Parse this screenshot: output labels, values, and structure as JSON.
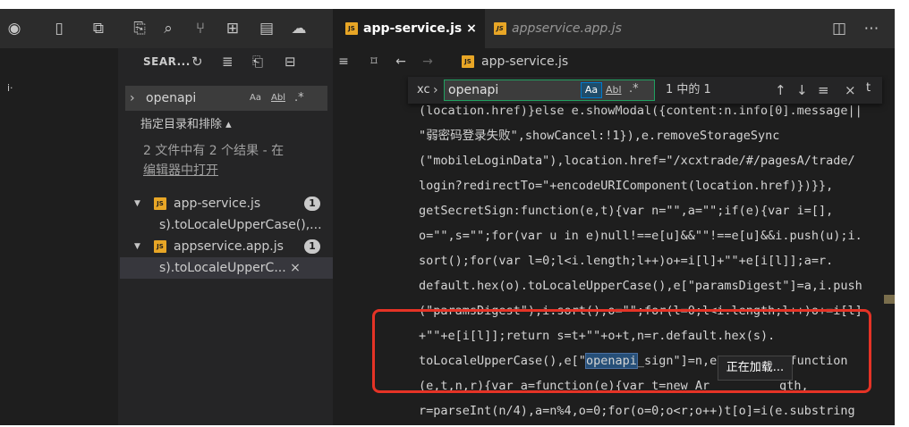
{
  "sidebar": {
    "title": "SEAR...",
    "search_value": "openapi",
    "opt_case": "Aa",
    "opt_word": "Abl",
    "opt_regex": ".*",
    "include_toggle": "指定目录和排除 ▴",
    "summary": "2 文件中有 2 个结果 - 在",
    "summary_link": "编辑器中打开",
    "results": [
      {
        "file": "app-service.js",
        "count": "1",
        "match": "s).toLocaleUpperCase(),..."
      },
      {
        "file": "appservice.app.js",
        "count": "1",
        "match": "s).toLocaleUpperC... ×"
      }
    ]
  },
  "tabs": [
    {
      "label": "app-service.js ×"
    },
    {
      "label": "appservice.app.js"
    }
  ],
  "breadcrumb": {
    "file": "app-service.js"
  },
  "find": {
    "prefix": "xc",
    "value": "openapi",
    "case_label": "Aa",
    "word_label": "Abl",
    "regex_label": ".*",
    "count": "1 中的 1",
    "suffix": "t"
  },
  "code_lines": [
    "(location.href)}else e.showModal({content:n.info[0].message||",
    "\"弱密码登录失败\",showCancel:!1}),e.removeStorageSync",
    "(\"mobileLoginData\"),location.href=\"/xcxtrade/#/pagesA/trade/",
    "login?redirectTo=\"+encodeURIComponent(location.href)})}},",
    "getSecretSign:function(e,t){var n=\"\",a=\"\";if(e){var i=[],",
    "o=\"\",s=\"\";for(var u in e)null!==e[u]&&\"\"!==e[u]&&i.push(u);i.",
    "sort();for(var l=0;l<i.length;l++)o+=i[l]+\"\"+e[i[l]];a=r.",
    "default.hex(o).toLocaleUpperCase(),e[\"paramsDigest\"]=a,i.push",
    "(\"paramsDigest\"),i.sort(),o=\"\";for(l=0;l<i.length;l++)o+=i[l]",
    "+\"\"+e[i[l]];return s=t+\"\"+o+t,n=r.default.hex(s).",
    "toLocaleUpperCase(),e[\"",
    "(e,t,n,r){var a=function(e){var t=new Ar",
    "r=parseInt(n/4),a=n%4,o=0;for(o=0;o<r;o++)t[o]=i(e.substring"
  ],
  "code_line10_match": "openapi",
  "code_line10_rest": "_sign\"]=n,e}},strEnc:function",
  "code_line11_tail": "gth,",
  "tooltip": "正在加载...",
  "colors": {
    "accent": "#007acc",
    "highlight": "#e53326",
    "js_badge": "#e8a626"
  }
}
